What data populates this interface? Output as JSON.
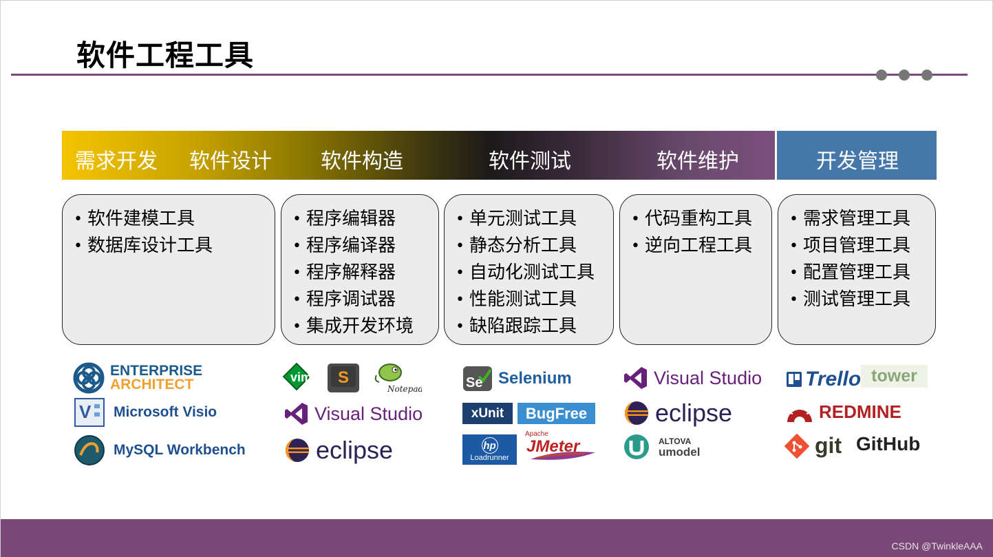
{
  "title": "软件工程工具",
  "phases": [
    "需求开发",
    "软件设计",
    "软件构造",
    "软件测试",
    "软件维护"
  ],
  "management": "开发管理",
  "boxes": [
    [
      "软件建模工具",
      "数据库设计工具"
    ],
    [
      "程序编辑器",
      "程序编译器",
      "程序解释器",
      "程序调试器",
      "集成开发环境"
    ],
    [
      "单元测试工具",
      "静态分析工具",
      "自动化测试工具",
      "性能测试工具",
      "缺陷跟踪工具"
    ],
    [
      "代码重构工具",
      "逆向工程工具"
    ],
    [
      "需求管理工具",
      "项目管理工具",
      "配置管理工具",
      "测试管理工具"
    ]
  ],
  "logos": {
    "ea_line1": "ENTERPRISE",
    "ea_line2": "ARCHITECT",
    "visio": "Microsoft Visio",
    "mysql": "MySQL Workbench",
    "vim": "vim",
    "sublime": "S",
    "notepad": "Notepad++",
    "vs": "Visual Studio",
    "eclipse": "eclipse",
    "selenium": "Selenium",
    "se": "Se",
    "xunit": "xUnit",
    "bugfree": "BugFree",
    "hp": "hp",
    "loadrunner": "Loadrunner",
    "apache": "Apache",
    "jmeter": "JMeter",
    "altova": "ALTOVA",
    "umodel": "umodel",
    "trello": "Trello",
    "tower": "tower",
    "redmine": "REDMINE",
    "git": "git",
    "github": "GitHub"
  },
  "credit": "CSDN @TwinkleAAA",
  "colors": {
    "accent": "#7a4b7a",
    "management": "#4577a8",
    "footer": "#7a4876"
  }
}
